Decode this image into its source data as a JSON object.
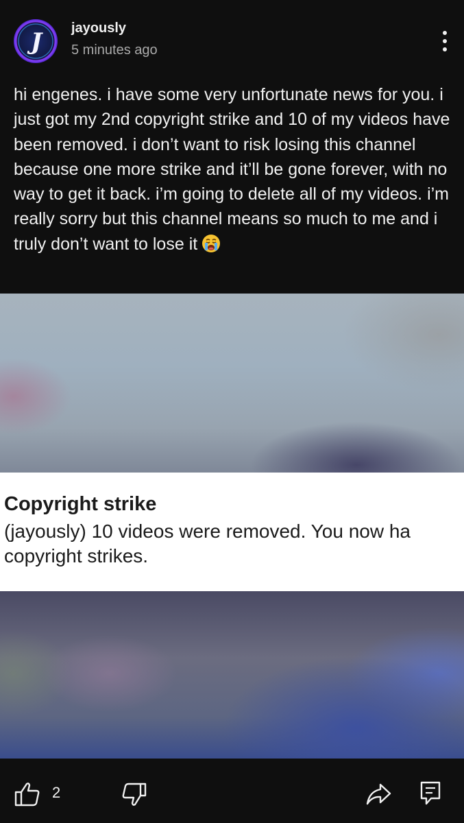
{
  "post": {
    "author": "jayously",
    "timestamp": "5 minutes ago",
    "avatar_initial": "J",
    "text": "hi engenes. i have some very unfortunate news for you. i just got my 2nd copyright strike and 10 of my videos have been removed. i don’t want to risk losing this channel because one more strike and it’ll be gone forever, with no way to get it back. i’m going to delete all of my videos. i’m really sorry but this channel means so much to me and i truly don’t want to lose it",
    "emoji": "loudly-crying-face"
  },
  "attachment": {
    "notice_title": "Copyright strike",
    "notice_body": "(jayously) 10 videos were removed. You now ha\ncopyright strikes."
  },
  "actions": {
    "like_count": "2",
    "like_icon": "thumbs-up-icon",
    "dislike_icon": "thumbs-down-icon",
    "share_icon": "share-icon",
    "comment_icon": "comment-icon"
  },
  "colors": {
    "background": "#0f0f0f",
    "text": "#f1f1f1",
    "secondary_text": "#aaaaaa",
    "avatar_accent": "#5b2bd6"
  }
}
